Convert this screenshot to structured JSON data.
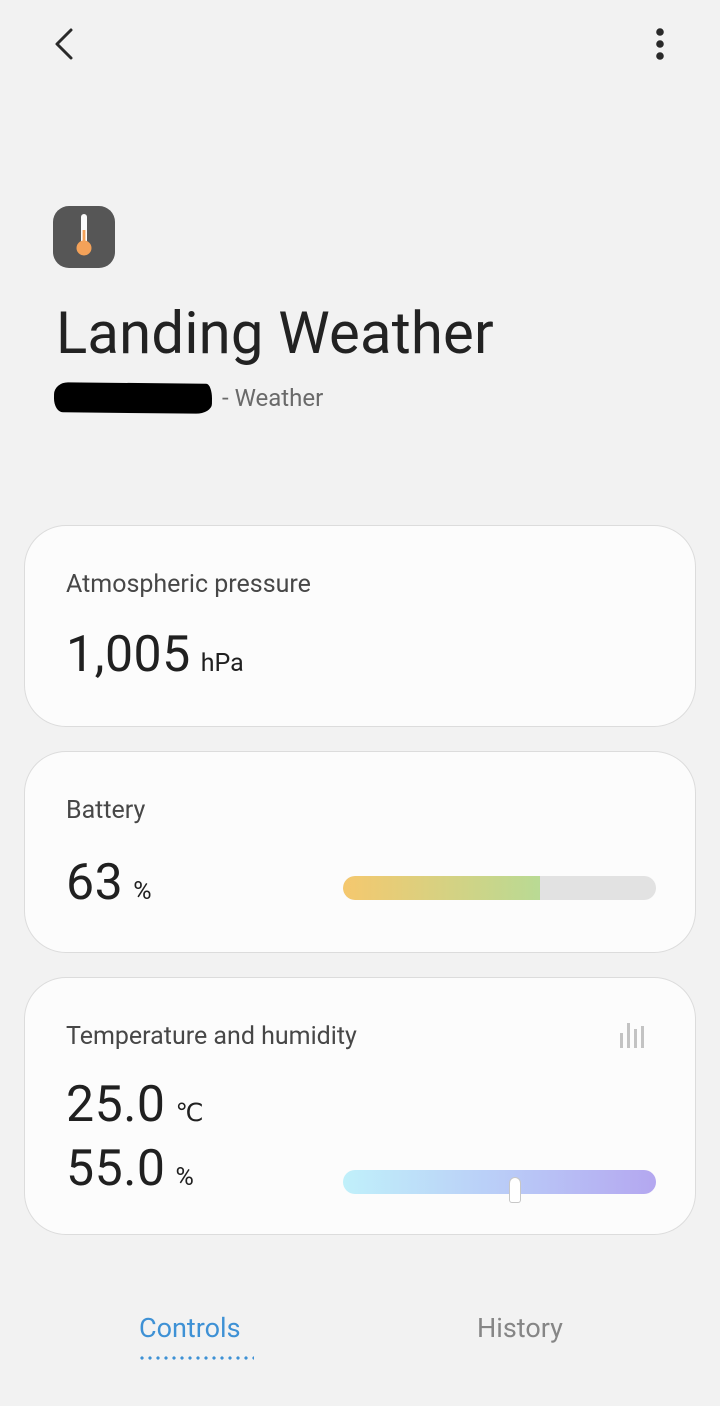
{
  "device": {
    "name": "Landing Weather",
    "subtitle": "- Weather",
    "icon": "thermometer-icon"
  },
  "cards": {
    "pressure": {
      "label": "Atmospheric pressure",
      "value": "1,005",
      "unit": "hPa"
    },
    "battery": {
      "label": "Battery",
      "value": "63",
      "unit": "%",
      "level_percent": 63
    },
    "temp_humidity": {
      "label": "Temperature and humidity",
      "temperature": "25.0",
      "temperature_unit": "℃",
      "humidity": "55.0",
      "humidity_unit": "%",
      "humidity_percent": 55,
      "history_icon": "bar-chart-icon"
    }
  },
  "tabs": [
    {
      "label": "Controls",
      "active": true
    },
    {
      "label": "History",
      "active": false
    }
  ],
  "colors": {
    "accent": "#3e91d5",
    "battery_gradient_start": "#f5c86e",
    "battery_gradient_end": "#b9da94",
    "humidity_gradient_start": "#c0f0fa",
    "humidity_gradient_end": "#b4a7f0"
  }
}
